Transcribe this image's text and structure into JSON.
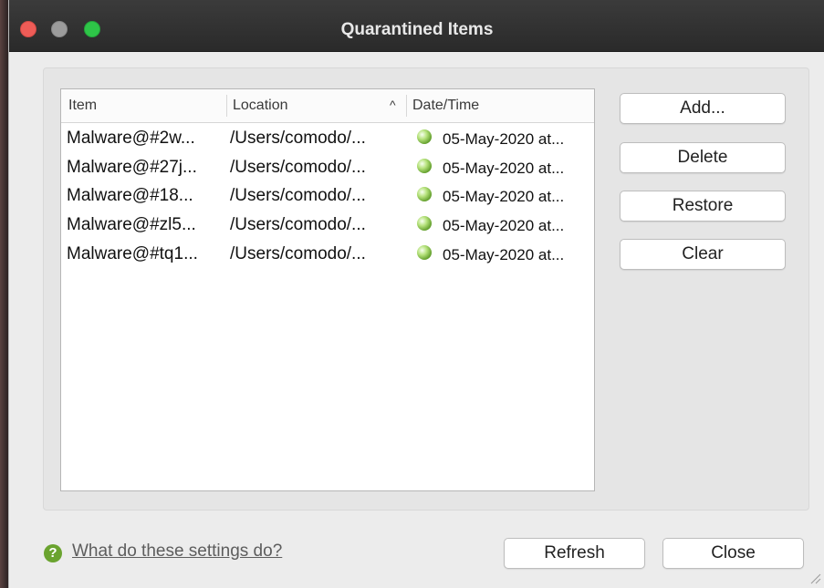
{
  "window": {
    "title": "Quarantined Items"
  },
  "table": {
    "columns": {
      "item": "Item",
      "location": "Location",
      "datetime": "Date/Time"
    },
    "sort_indicator": "^",
    "rows": [
      {
        "item": "Malware@#2w...",
        "location": "/Users/comodo/...",
        "datetime": "05-May-2020 at..."
      },
      {
        "item": "Malware@#27j...",
        "location": "/Users/comodo/...",
        "datetime": "05-May-2020 at..."
      },
      {
        "item": "Malware@#18...",
        "location": "/Users/comodo/...",
        "datetime": "05-May-2020 at..."
      },
      {
        "item": "Malware@#zl5...",
        "location": "/Users/comodo/...",
        "datetime": "05-May-2020 at..."
      },
      {
        "item": "Malware@#tq1...",
        "location": "/Users/comodo/...",
        "datetime": "05-May-2020 at..."
      }
    ]
  },
  "actions": {
    "add": "Add...",
    "delete": "Delete",
    "restore": "Restore",
    "clear": "Clear"
  },
  "footer": {
    "help_icon": "?",
    "help_link": "What do these settings do?",
    "refresh": "Refresh",
    "close": "Close"
  },
  "colors": {
    "titlebar": "#2f2f2f",
    "close": "#ee5c57",
    "maximize": "#2ec548",
    "status_icon": "#6aa32f"
  }
}
